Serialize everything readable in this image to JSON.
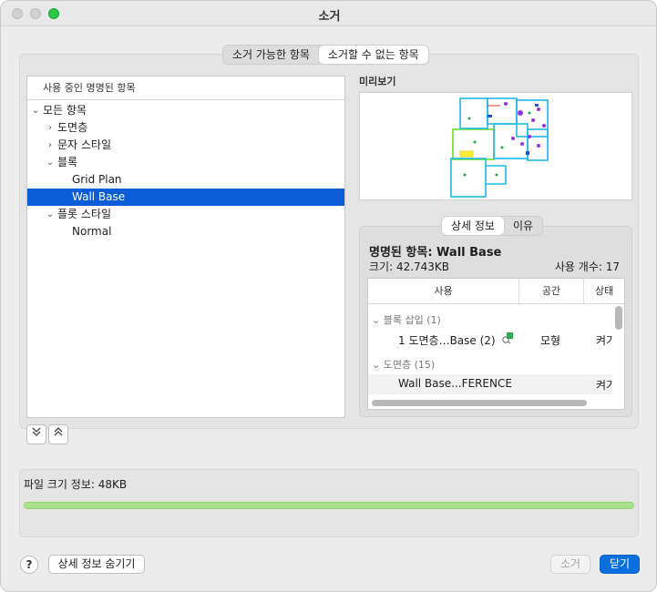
{
  "window": {
    "title": "소거"
  },
  "tabs": [
    {
      "label": "소거 가능한 항목",
      "active": false
    },
    {
      "label": "소거할 수 없는 항목",
      "active": true
    }
  ],
  "tree": {
    "header": "사용 중인 명명된 항목",
    "items": [
      {
        "label": "모든 항목",
        "chevron": "down"
      },
      {
        "label": "도면층",
        "chevron": "right"
      },
      {
        "label": "문자 스타일",
        "chevron": "right"
      },
      {
        "label": "블록",
        "chevron": "down"
      },
      {
        "label": "Grid Plan",
        "chevron": ""
      },
      {
        "label": "Wall Base",
        "chevron": "",
        "selected": true
      },
      {
        "label": "플롯 스타일",
        "chevron": "down"
      },
      {
        "label": "Normal",
        "chevron": ""
      }
    ]
  },
  "preview": {
    "label": "미리보기"
  },
  "detail_tabs": [
    {
      "label": "상세 정보",
      "active": true
    },
    {
      "label": "이유",
      "active": false
    }
  ],
  "details": {
    "named_item": "명명된 항목: Wall Base",
    "size": "크기: 42.743KB",
    "usage_count": "사용 개수: 17",
    "columns": [
      "사용",
      "공간",
      "상태"
    ],
    "groups": [
      {
        "label": "블록 삽입 (1)",
        "rows": [
          {
            "use": "1 도면층…Base (2)",
            "space": "모형",
            "state": "켜기"
          }
        ]
      },
      {
        "label": "도면층 (15)",
        "rows": [
          {
            "use": "Wall Base...FERENCE",
            "space": "",
            "state": "켜기"
          }
        ]
      }
    ]
  },
  "file_info": {
    "label": "파일 크기 정보: 48KB",
    "progress": 1.0
  },
  "buttons": {
    "help": "?",
    "hide_details": "상세 정보 숨기기",
    "purge": "소거",
    "close": "닫기"
  },
  "colors": {
    "accent": "#0b5cd7",
    "progress": "#a9e08a",
    "close_button": "#0b6fe0"
  }
}
